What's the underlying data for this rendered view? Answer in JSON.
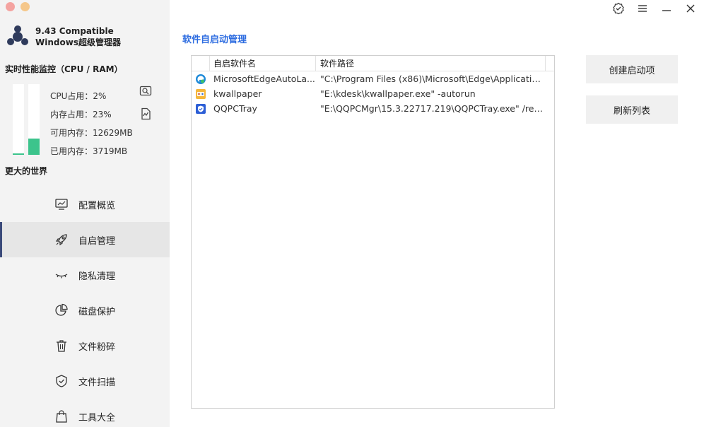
{
  "app": {
    "title_line1": "9.43 Compatible",
    "title_line2": "Windows超级管理器"
  },
  "perf": {
    "title": "实时性能监控（CPU / RAM）",
    "cpu_usage_percent": 2,
    "mem_usage_percent": 23,
    "cpu_label": "CPU占用：2%",
    "mem_label": "内存占用：23%",
    "free_mem_label": "可用内存：12629MB",
    "used_mem_label": "已用内存：3719MB",
    "bar_color": "#3cc48c"
  },
  "slogan": "更大的世界",
  "nav": {
    "items": [
      {
        "label": "配置概览",
        "icon": "monitor-chart-icon"
      },
      {
        "label": "自启管理",
        "icon": "rocket-icon",
        "active": true
      },
      {
        "label": "隐私清理",
        "icon": "closed-eye-icon"
      },
      {
        "label": "磁盘保护",
        "icon": "pie-chart-icon"
      },
      {
        "label": "文件粉碎",
        "icon": "trash-icon"
      },
      {
        "label": "文件扫描",
        "icon": "shield-check-icon"
      },
      {
        "label": "工具大全",
        "icon": "shopping-bag-icon"
      }
    ]
  },
  "main": {
    "title": "软件自启动管理",
    "accent_color": "#2d6ce0",
    "columns": [
      "",
      "自启软件名",
      "软件路径"
    ],
    "rows": [
      {
        "icon": "edge-icon",
        "name": "MicrosoftEdgeAutoLa...",
        "path": "\"C:\\Program Files (x86)\\Microsoft\\Edge\\Application\\..."
      },
      {
        "icon": "kwallpaper-icon",
        "name": "kwallpaper",
        "path": "\"E:\\kdesk\\kwallpaper.exe\" -autorun"
      },
      {
        "icon": "qqpc-icon",
        "name": " QQPCTray",
        "path": "\"E:\\QQPCMgr\\15.3.22717.219\\QQPCTray.exe\"  /regr..."
      }
    ]
  },
  "buttons": {
    "create": "创建启动项",
    "refresh": "刷新列表"
  },
  "window_controls": [
    "badge-check-icon",
    "menu-icon",
    "minimize-icon",
    "close-icon"
  ]
}
